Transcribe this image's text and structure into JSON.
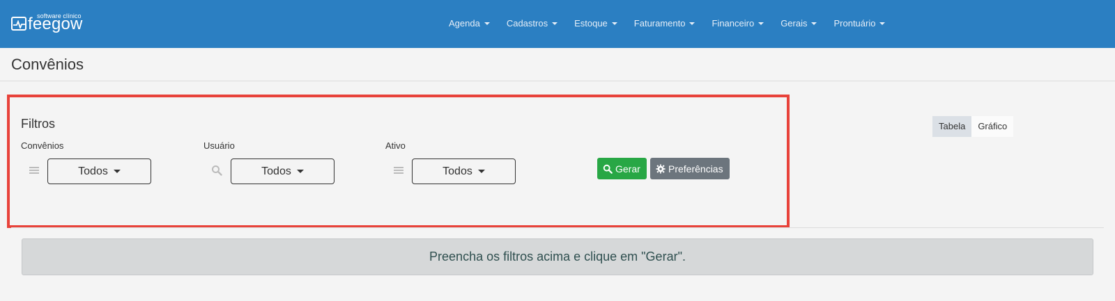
{
  "app": {
    "logo_subtitle": "software clínico",
    "logo_text": "feegow"
  },
  "nav": {
    "items": [
      {
        "label": "Agenda"
      },
      {
        "label": "Cadastros"
      },
      {
        "label": "Estoque"
      },
      {
        "label": "Faturamento"
      },
      {
        "label": "Financeiro"
      },
      {
        "label": "Gerais"
      },
      {
        "label": "Prontuário"
      }
    ]
  },
  "page": {
    "title": "Convênios"
  },
  "filters": {
    "title": "Filtros",
    "convenios": {
      "label": "Convênios",
      "value": "Todos"
    },
    "usuario": {
      "label": "Usuário",
      "value": "Todos"
    },
    "ativo": {
      "label": "Ativo",
      "value": "Todos"
    }
  },
  "actions": {
    "gerar_label": "Gerar",
    "preferencias_label": "Preferências"
  },
  "view_toggle": {
    "tabela_label": "Tabela",
    "grafico_label": "Gráfico",
    "selected": "Tabela"
  },
  "message": {
    "text": "Preencha os filtros acima e clique em \"Gerar\"."
  },
  "colors": {
    "navbar": "#2b7fc2",
    "highlight_border": "#e8423a",
    "gerar_button": "#28a745",
    "preferencias_button": "#6c757d"
  }
}
